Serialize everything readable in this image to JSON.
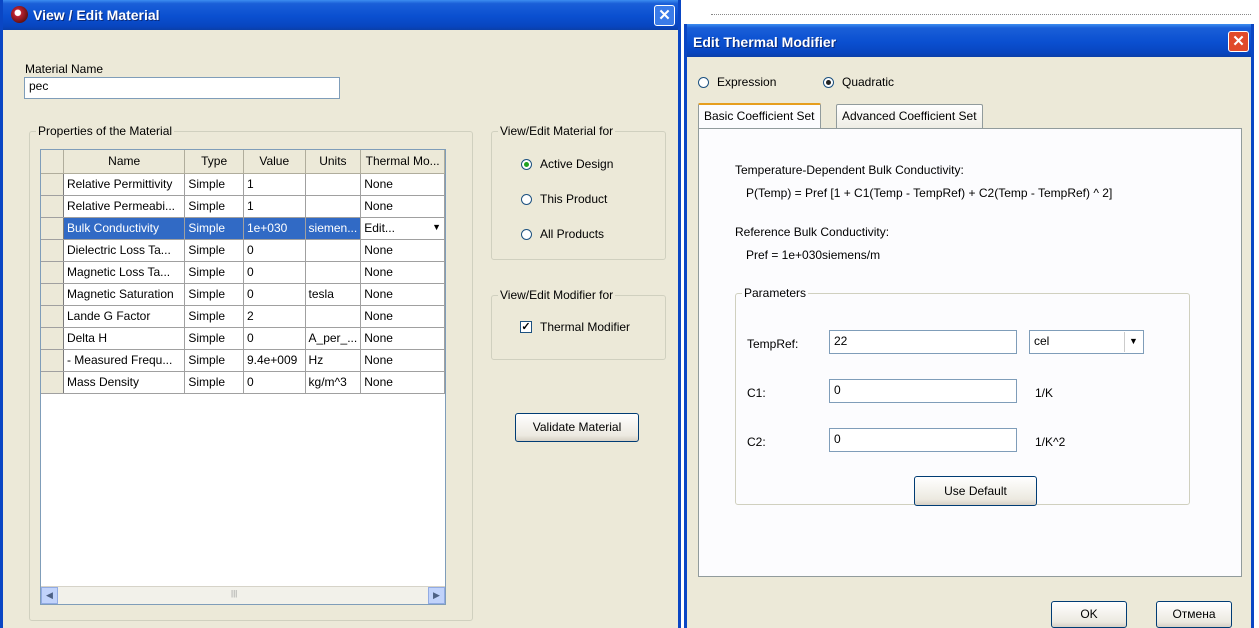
{
  "material_window": {
    "title": "View / Edit Material",
    "material_name_label": "Material Name",
    "material_name_value": "pec",
    "properties_group": "Properties of the Material",
    "columns": [
      "Name",
      "Type",
      "Value",
      "Units",
      "Thermal Mo..."
    ],
    "rows": [
      {
        "name": "Relative Permittivity",
        "type": "Simple",
        "value": "1",
        "units": "",
        "thermal": "None"
      },
      {
        "name": "Relative Permeabi...",
        "type": "Simple",
        "value": "1",
        "units": "",
        "thermal": "None"
      },
      {
        "name": "Bulk Conductivity",
        "type": "Simple",
        "value": "1e+030",
        "units": "siemen...",
        "thermal": "Edit..."
      },
      {
        "name": "Dielectric Loss Ta...",
        "type": "Simple",
        "value": "0",
        "units": "",
        "thermal": "None"
      },
      {
        "name": "Magnetic Loss Ta...",
        "type": "Simple",
        "value": "0",
        "units": "",
        "thermal": "None"
      },
      {
        "name": "Magnetic Saturation",
        "type": "Simple",
        "value": "0",
        "units": "tesla",
        "thermal": "None"
      },
      {
        "name": "Lande G Factor",
        "type": "Simple",
        "value": "2",
        "units": "",
        "thermal": "None"
      },
      {
        "name": "Delta H",
        "type": "Simple",
        "value": "0",
        "units": "A_per_...",
        "thermal": "None"
      },
      {
        "name": "- Measured Frequ...",
        "type": "Simple",
        "value": "9.4e+009",
        "units": "Hz",
        "thermal": "None"
      },
      {
        "name": "Mass Density",
        "type": "Simple",
        "value": "0",
        "units": "kg/m^3",
        "thermal": "None"
      }
    ],
    "selected_row": 2,
    "view_edit_for_group": "View/Edit Material for",
    "view_edit_options": [
      "Active Design",
      "This Product",
      "All Products"
    ],
    "view_edit_selected": "Active Design",
    "modifier_group": "View/Edit Modifier for",
    "thermal_modifier_label": "Thermal Modifier",
    "thermal_modifier_checked": true,
    "validate_button": "Validate Material"
  },
  "thermal_window": {
    "title": "Edit Thermal Modifier",
    "mode_options": [
      "Expression",
      "Quadratic"
    ],
    "mode_selected": "Quadratic",
    "tabs": [
      "Basic Coefficient Set",
      "Advanced Coefficient Set"
    ],
    "active_tab": "Basic Coefficient Set",
    "dependency_heading": "Temperature-Dependent Bulk Conductivity:",
    "formula": "P(Temp) = Pref [1 + C1(Temp - TempRef) + C2(Temp - TempRef) ^ 2]",
    "reference_heading": "Reference Bulk Conductivity:",
    "pref_text": "Pref = 1e+030siemens/m",
    "parameters_group": "Parameters",
    "tempref_label": "TempRef:",
    "tempref_value": "22",
    "tempref_unit": "cel",
    "c1_label": "C1:",
    "c1_value": "0",
    "c1_unit": "1/K",
    "c2_label": "C2:",
    "c2_value": "0",
    "c2_unit": "1/K^2",
    "use_default_button": "Use Default",
    "ok_button": "OK",
    "cancel_button": "Отмена"
  },
  "colors": {
    "titlebar": "#0a4fd0",
    "selection": "#316ac5",
    "dialog_bg": "#ece9d8",
    "close_red": "#e04a2a"
  }
}
